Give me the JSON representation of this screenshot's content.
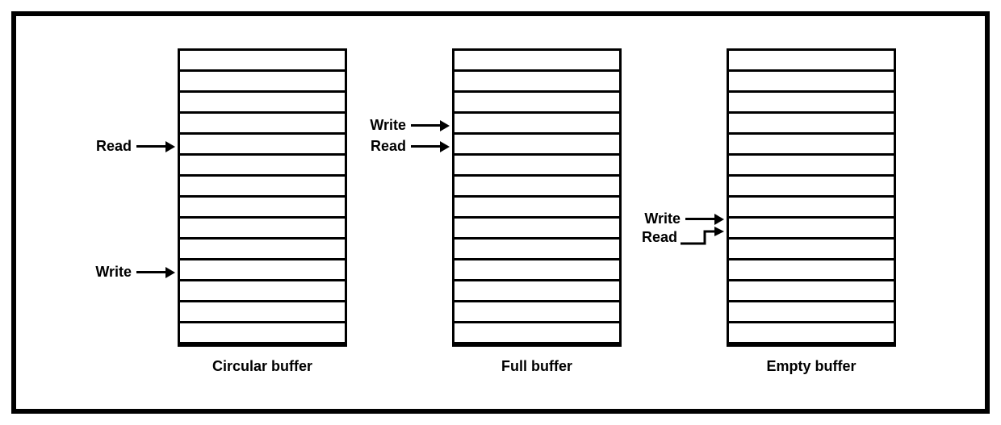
{
  "rows": 14,
  "diagrams": [
    {
      "id": "circular",
      "caption": "Circular buffer",
      "pointers": [
        {
          "label": "Read",
          "row": 4
        },
        {
          "label": "Write",
          "row": 10
        }
      ]
    },
    {
      "id": "full",
      "caption": "Full buffer",
      "pointers": [
        {
          "label": "Write",
          "row": 3
        },
        {
          "label": "Read",
          "row": 4
        }
      ]
    },
    {
      "id": "empty",
      "caption": "Empty buffer",
      "pointers_joined": {
        "row": 8,
        "top_label": "Write",
        "bottom_label": "Read"
      }
    }
  ]
}
